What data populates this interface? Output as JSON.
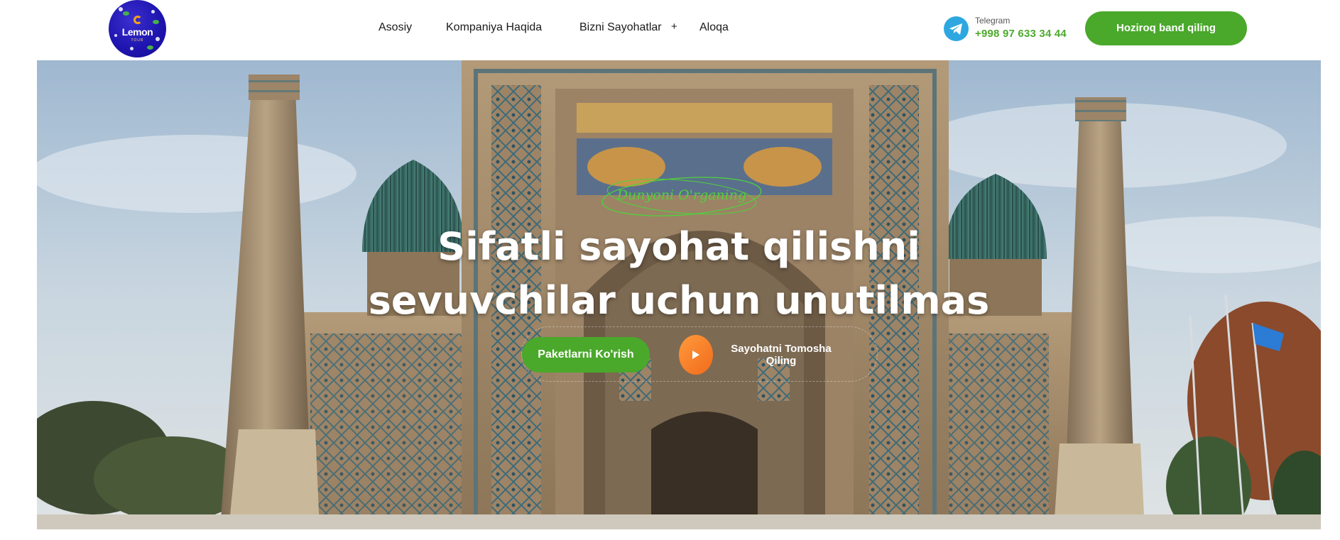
{
  "header": {
    "logo": {
      "text": "Lemon",
      "subtext": "TOUR"
    },
    "nav": [
      {
        "label": "Asosiy"
      },
      {
        "label": "Kompaniya Haqida"
      },
      {
        "label": "Bizni Sayohatlar",
        "submenu_icon": "+"
      },
      {
        "label": "Aloqa"
      }
    ],
    "contact": {
      "icon": "telegram-icon",
      "label": "Telegram",
      "phone": "+998 97 633 34 44"
    },
    "book_button": "Hoziroq band qiling"
  },
  "hero": {
    "eyebrow": "Dunyoni O'rganing",
    "headline_line1": "Sifatli sayohat qilishni",
    "headline_line2": "sevuvchilar uchun unutilmas",
    "primary_cta": "Paketlarni Ko'rish",
    "play_icon": "play-icon",
    "watch_cta": "Sayohatni Tomosha Qiling"
  },
  "colors": {
    "accent_green": "#4aa82b",
    "phone_green": "#4caa2c",
    "eyebrow_green": "#4fd23a",
    "play_orange": "#f16b1b",
    "telegram_blue": "#2ea7e0",
    "logo_blue": "#1f15b0"
  }
}
